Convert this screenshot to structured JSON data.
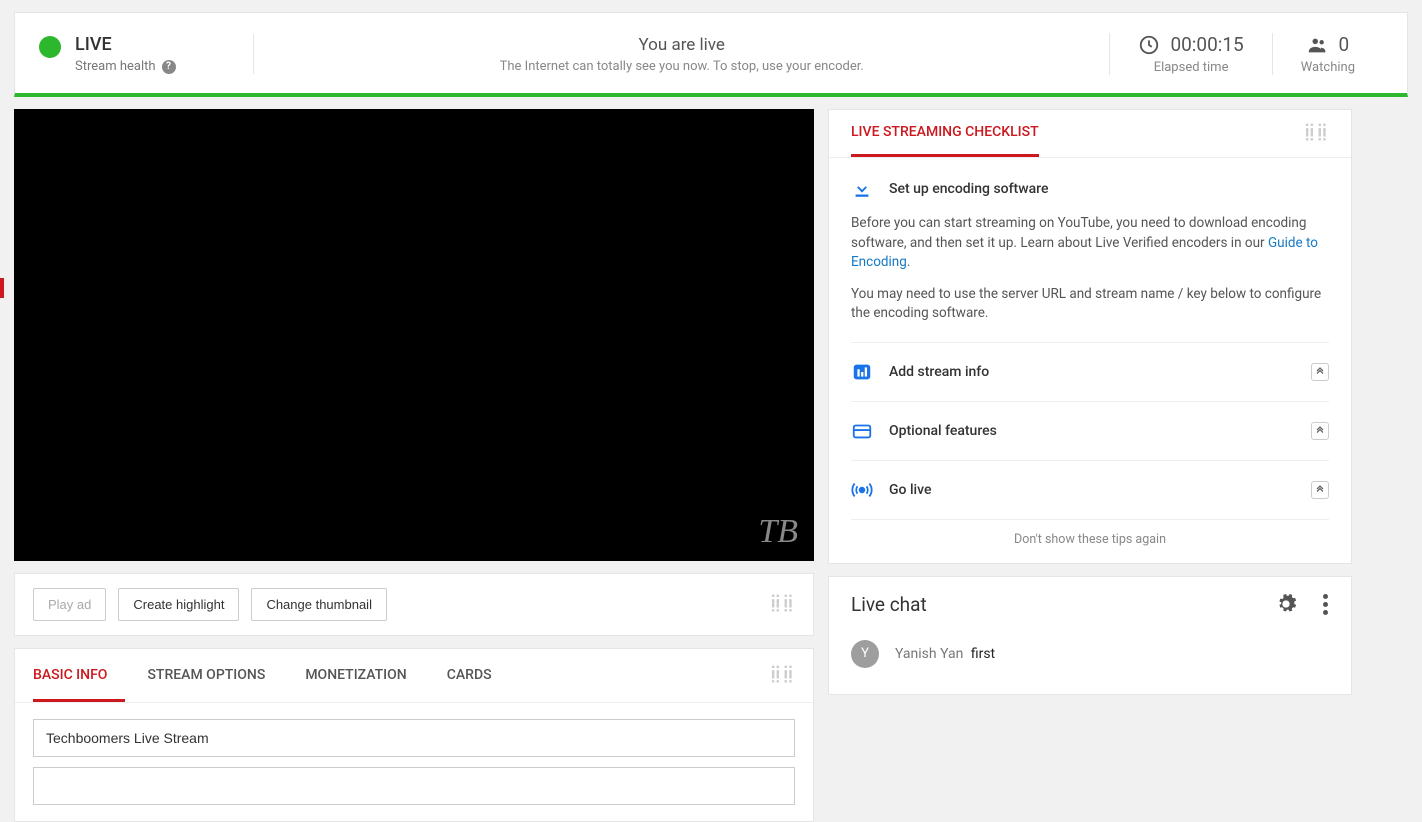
{
  "status": {
    "live_label": "LIVE",
    "stream_health_label": "Stream health",
    "center_title": "You are live",
    "center_sub": "The Internet can totally see you now. To stop, use your encoder.",
    "elapsed_value": "00:00:15",
    "elapsed_label": "Elapsed time",
    "watching_value": "0",
    "watching_label": "Watching"
  },
  "actions": {
    "play_ad": "Play ad",
    "create_highlight": "Create highlight",
    "change_thumbnail": "Change thumbnail"
  },
  "tabs": {
    "items": [
      "BASIC INFO",
      "STREAM OPTIONS",
      "MONETIZATION",
      "CARDS"
    ],
    "active_index": 0,
    "title_value": "Techboomers Live Stream"
  },
  "checklist": {
    "title": "LIVE STREAMING CHECKLIST",
    "first": {
      "label": "Set up encoding software",
      "desc1_pre": "Before you can start streaming on YouTube, you need to download encoding software, and then set it up. Learn about Live Verified encoders in our ",
      "desc1_link": "Guide to Encoding",
      "desc1_post": ".",
      "desc2": "You may need to use the server URL and stream name / key below to configure the encoding software."
    },
    "rows": [
      {
        "label": "Add stream info"
      },
      {
        "label": "Optional features"
      },
      {
        "label": "Go live"
      }
    ],
    "dont_show": "Don't show these tips again"
  },
  "chat": {
    "title": "Live chat",
    "messages": [
      {
        "avatar_initial": "Y",
        "user": "Yanish Yan",
        "text": "first"
      }
    ]
  },
  "watermark": "TB"
}
